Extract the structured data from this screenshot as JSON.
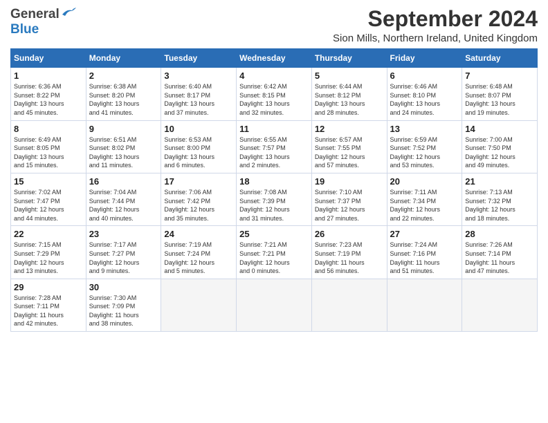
{
  "header": {
    "logo_general": "General",
    "logo_blue": "Blue",
    "title": "September 2024",
    "subtitle": "Sion Mills, Northern Ireland, United Kingdom"
  },
  "weekdays": [
    "Sunday",
    "Monday",
    "Tuesday",
    "Wednesday",
    "Thursday",
    "Friday",
    "Saturday"
  ],
  "weeks": [
    [
      {
        "day": "1",
        "info": "Sunrise: 6:36 AM\nSunset: 8:22 PM\nDaylight: 13 hours\nand 45 minutes."
      },
      {
        "day": "2",
        "info": "Sunrise: 6:38 AM\nSunset: 8:20 PM\nDaylight: 13 hours\nand 41 minutes."
      },
      {
        "day": "3",
        "info": "Sunrise: 6:40 AM\nSunset: 8:17 PM\nDaylight: 13 hours\nand 37 minutes."
      },
      {
        "day": "4",
        "info": "Sunrise: 6:42 AM\nSunset: 8:15 PM\nDaylight: 13 hours\nand 32 minutes."
      },
      {
        "day": "5",
        "info": "Sunrise: 6:44 AM\nSunset: 8:12 PM\nDaylight: 13 hours\nand 28 minutes."
      },
      {
        "day": "6",
        "info": "Sunrise: 6:46 AM\nSunset: 8:10 PM\nDaylight: 13 hours\nand 24 minutes."
      },
      {
        "day": "7",
        "info": "Sunrise: 6:48 AM\nSunset: 8:07 PM\nDaylight: 13 hours\nand 19 minutes."
      }
    ],
    [
      {
        "day": "8",
        "info": "Sunrise: 6:49 AM\nSunset: 8:05 PM\nDaylight: 13 hours\nand 15 minutes."
      },
      {
        "day": "9",
        "info": "Sunrise: 6:51 AM\nSunset: 8:02 PM\nDaylight: 13 hours\nand 11 minutes."
      },
      {
        "day": "10",
        "info": "Sunrise: 6:53 AM\nSunset: 8:00 PM\nDaylight: 13 hours\nand 6 minutes."
      },
      {
        "day": "11",
        "info": "Sunrise: 6:55 AM\nSunset: 7:57 PM\nDaylight: 13 hours\nand 2 minutes."
      },
      {
        "day": "12",
        "info": "Sunrise: 6:57 AM\nSunset: 7:55 PM\nDaylight: 12 hours\nand 57 minutes."
      },
      {
        "day": "13",
        "info": "Sunrise: 6:59 AM\nSunset: 7:52 PM\nDaylight: 12 hours\nand 53 minutes."
      },
      {
        "day": "14",
        "info": "Sunrise: 7:00 AM\nSunset: 7:50 PM\nDaylight: 12 hours\nand 49 minutes."
      }
    ],
    [
      {
        "day": "15",
        "info": "Sunrise: 7:02 AM\nSunset: 7:47 PM\nDaylight: 12 hours\nand 44 minutes."
      },
      {
        "day": "16",
        "info": "Sunrise: 7:04 AM\nSunset: 7:44 PM\nDaylight: 12 hours\nand 40 minutes."
      },
      {
        "day": "17",
        "info": "Sunrise: 7:06 AM\nSunset: 7:42 PM\nDaylight: 12 hours\nand 35 minutes."
      },
      {
        "day": "18",
        "info": "Sunrise: 7:08 AM\nSunset: 7:39 PM\nDaylight: 12 hours\nand 31 minutes."
      },
      {
        "day": "19",
        "info": "Sunrise: 7:10 AM\nSunset: 7:37 PM\nDaylight: 12 hours\nand 27 minutes."
      },
      {
        "day": "20",
        "info": "Sunrise: 7:11 AM\nSunset: 7:34 PM\nDaylight: 12 hours\nand 22 minutes."
      },
      {
        "day": "21",
        "info": "Sunrise: 7:13 AM\nSunset: 7:32 PM\nDaylight: 12 hours\nand 18 minutes."
      }
    ],
    [
      {
        "day": "22",
        "info": "Sunrise: 7:15 AM\nSunset: 7:29 PM\nDaylight: 12 hours\nand 13 minutes."
      },
      {
        "day": "23",
        "info": "Sunrise: 7:17 AM\nSunset: 7:27 PM\nDaylight: 12 hours\nand 9 minutes."
      },
      {
        "day": "24",
        "info": "Sunrise: 7:19 AM\nSunset: 7:24 PM\nDaylight: 12 hours\nand 5 minutes."
      },
      {
        "day": "25",
        "info": "Sunrise: 7:21 AM\nSunset: 7:21 PM\nDaylight: 12 hours\nand 0 minutes."
      },
      {
        "day": "26",
        "info": "Sunrise: 7:23 AM\nSunset: 7:19 PM\nDaylight: 11 hours\nand 56 minutes."
      },
      {
        "day": "27",
        "info": "Sunrise: 7:24 AM\nSunset: 7:16 PM\nDaylight: 11 hours\nand 51 minutes."
      },
      {
        "day": "28",
        "info": "Sunrise: 7:26 AM\nSunset: 7:14 PM\nDaylight: 11 hours\nand 47 minutes."
      }
    ],
    [
      {
        "day": "29",
        "info": "Sunrise: 7:28 AM\nSunset: 7:11 PM\nDaylight: 11 hours\nand 42 minutes."
      },
      {
        "day": "30",
        "info": "Sunrise: 7:30 AM\nSunset: 7:09 PM\nDaylight: 11 hours\nand 38 minutes."
      },
      {
        "day": "",
        "info": ""
      },
      {
        "day": "",
        "info": ""
      },
      {
        "day": "",
        "info": ""
      },
      {
        "day": "",
        "info": ""
      },
      {
        "day": "",
        "info": ""
      }
    ]
  ]
}
